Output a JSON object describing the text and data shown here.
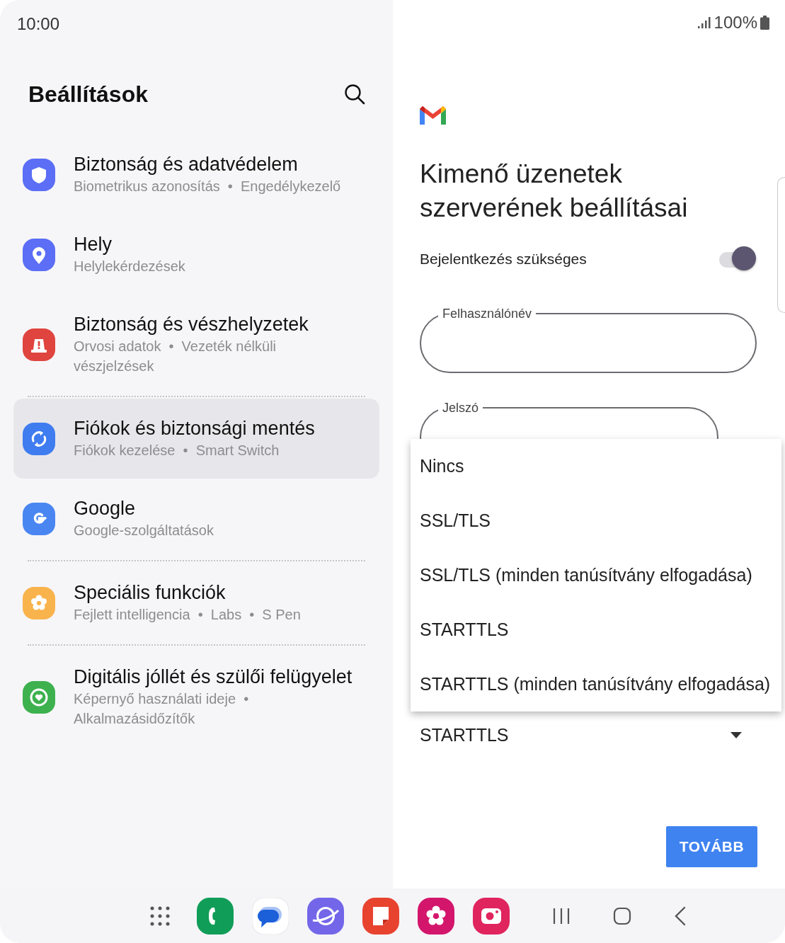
{
  "status_bar": {
    "time": "10:00",
    "battery": "100%"
  },
  "settings": {
    "title": "Beállítások",
    "sections": [
      {
        "items": [
          {
            "kind": "shield",
            "color": "#5b6ef5",
            "title": "Biztonság és adatvédelem",
            "subtitle": "Biometrikus azonosítás  •  Engedélykezelő",
            "selected": false
          },
          {
            "kind": "pin",
            "color": "#5b6ef5",
            "title": "Hely",
            "subtitle": "Helylekérdezések",
            "selected": false
          },
          {
            "kind": "siren",
            "color": "#e0443e",
            "title": "Biztonság és vészhelyzetek",
            "subtitle": "Orvosi adatok  •  Vezeték nélküli vészjelzések",
            "selected": false
          }
        ]
      },
      {
        "items": [
          {
            "kind": "sync",
            "color": "#3f7cf0",
            "title": "Fiókok és biztonsági mentés",
            "subtitle": "Fiókok kezelése  •  Smart Switch",
            "selected": true
          },
          {
            "kind": "google",
            "color": "#4a86f2",
            "title": "Google",
            "subtitle": "Google-szolgáltatások",
            "selected": false
          }
        ]
      },
      {
        "items": [
          {
            "kind": "flower",
            "color": "#f9b34c",
            "title": "Speciális funkciók",
            "subtitle": "Fejlett intelligencia  •  Labs  •  S Pen",
            "selected": false
          }
        ]
      },
      {
        "items": [
          {
            "kind": "heart",
            "color": "#3db14e",
            "title": "Digitális jóllét és szülői felügyelet",
            "subtitle": "Képernyő használati ideje  •  Alkalmazásidőzítők",
            "selected": false
          }
        ]
      }
    ]
  },
  "email_setup": {
    "title": "Kimenő üzenetek szerverének beállításai",
    "login_required": {
      "label": "Bejelentkezés szükséges",
      "on": true
    },
    "fields": [
      {
        "label": "Felhasználónév"
      },
      {
        "label": "Jelszó"
      }
    ],
    "security": {
      "value": "STARTTLS"
    },
    "next_button": "TOVÁBB",
    "dropdown": [
      {
        "label": "Nincs",
        "selected": false
      },
      {
        "label": "SSL/TLS",
        "selected": false
      },
      {
        "label": "SSL/TLS (minden tanúsítvány elfogadása)",
        "selected": false
      },
      {
        "label": "STARTTLS",
        "selected": false
      },
      {
        "label": "STARTTLS (minden tanúsítvány elfogadása)",
        "selected": false
      }
    ]
  },
  "dock": {
    "apps": [
      {
        "kind": "apps"
      },
      {
        "kind": "phone"
      },
      {
        "kind": "messages"
      },
      {
        "kind": "internet"
      },
      {
        "kind": "notes"
      },
      {
        "kind": "gallery"
      },
      {
        "kind": "camera"
      }
    ]
  }
}
